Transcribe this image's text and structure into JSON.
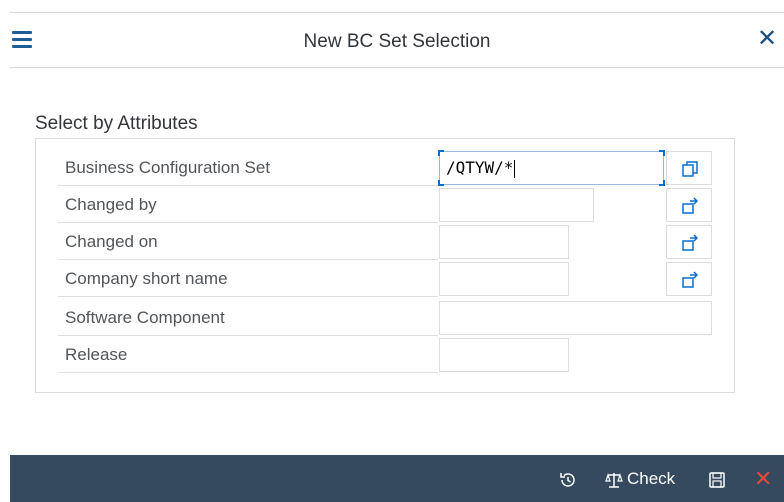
{
  "dialog": {
    "title": "New BC Set Selection",
    "close_glyph": "✕"
  },
  "section": {
    "title": "Select by Attributes"
  },
  "fields": [
    {
      "label": "Business Configuration Set",
      "value": "/QTYW/*",
      "focused": true,
      "button_icon": "multiple-selection-icon"
    },
    {
      "label": "Changed by",
      "value": "",
      "button_icon": "multiple-selection-arrow-icon"
    },
    {
      "label": "Changed on",
      "value": "",
      "button_icon": "multiple-selection-arrow-icon"
    },
    {
      "label": "Company short name",
      "value": "",
      "button_icon": "multiple-selection-arrow-icon"
    },
    {
      "label": "Software Component",
      "value": ""
    },
    {
      "label": "Release",
      "value": ""
    }
  ],
  "footer": {
    "check_label": "Check",
    "cancel_glyph": "✕"
  },
  "colors": {
    "footer_bg": "#354a5f",
    "accent": "#0a6ed1",
    "cancel": "#e8463c"
  }
}
